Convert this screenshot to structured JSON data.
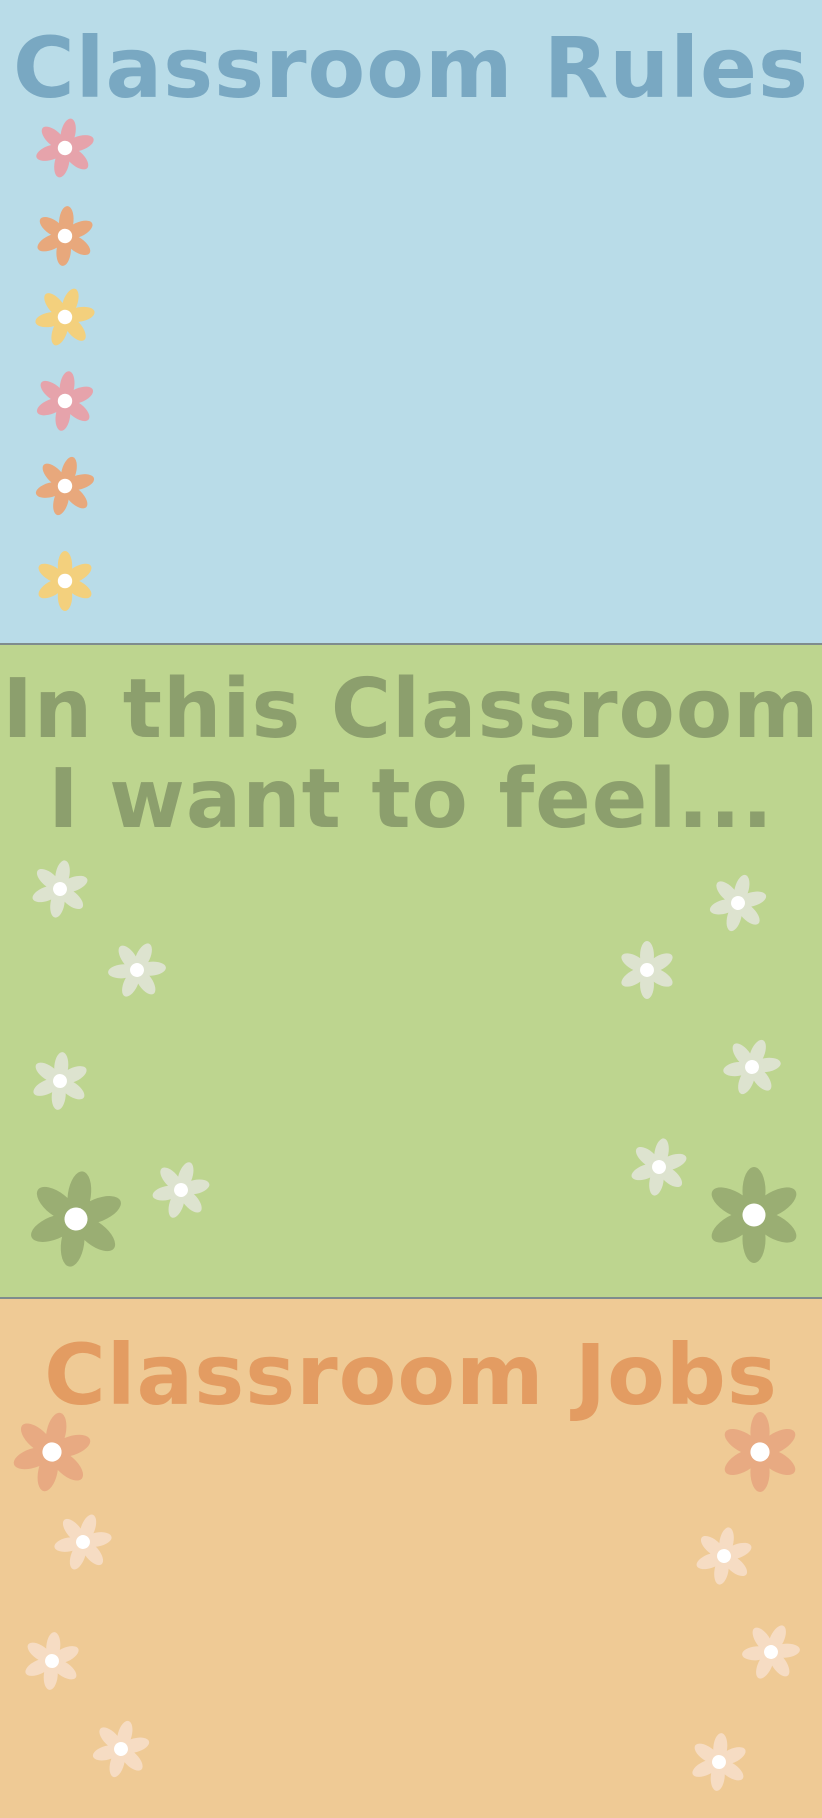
{
  "colors": {
    "rules_bg": "#b9dce8",
    "rules_title": "#79a8c2",
    "feel_bg": "#bdd58f",
    "feel_title": "#8c9f6d",
    "jobs_bg": "#efca95",
    "jobs_title": "#e39c62",
    "divider": "#7f8c8d",
    "flower_pink": "#e6a3ab",
    "flower_orange": "#e8a87c",
    "flower_yellow": "#f3d07d",
    "flower_pale_green": "#dde3cf",
    "flower_dark_green": "#9aae73",
    "flower_pale_peach": "#f6dcc3",
    "flower_peach": "#e8aa82",
    "flower_center": "#ffffff"
  },
  "sections": {
    "rules": {
      "title": "Classroom Rules"
    },
    "feel": {
      "title_line1": "In this Classroom",
      "title_line2": "I want to feel..."
    },
    "jobs": {
      "title": "Classroom Jobs"
    }
  },
  "decorations": {
    "flower_icon": "flower-icon"
  }
}
